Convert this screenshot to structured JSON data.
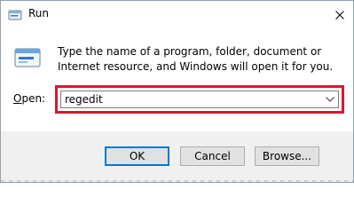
{
  "window": {
    "title": "Run"
  },
  "dialog": {
    "description": "Type the name of a program, folder, document or Internet resource, and Windows will open it for you.",
    "open_label_underlined": "O",
    "open_label_rest": "pen:",
    "input_value": "regedit"
  },
  "buttons": {
    "ok": "OK",
    "cancel": "Cancel",
    "browse": "Browse..."
  },
  "icons": {
    "title": "run-app-icon",
    "main": "run-app-icon",
    "close": "close-icon",
    "dropdown": "chevron-down-icon"
  },
  "colors": {
    "highlight_border": "#d8182f",
    "default_button_border": "#0078d7",
    "footer_background": "#f0f0f0"
  }
}
